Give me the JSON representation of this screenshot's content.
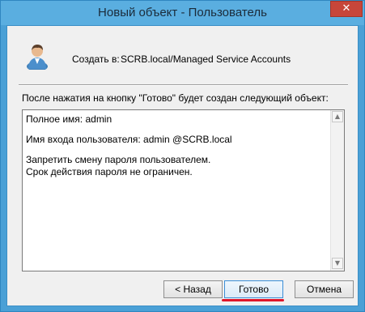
{
  "window": {
    "title": "Новый объект - Пользователь",
    "close_glyph": "✕"
  },
  "header": {
    "create_in_label": "Создать в:",
    "path": "SCRB.local/Managed Service Accounts"
  },
  "info_label": "После нажатия на кнопку \"Готово\" будет создан следующий объект:",
  "summary_lines": [
    "Полное имя: admin",
    "Имя входа пользователя: admin @SCRB.local",
    "Запретить смену пароля пользователем.",
    "Срок действия пароля не ограничен."
  ],
  "buttons": {
    "back": "< Назад",
    "finish": "Готово",
    "cancel": "Отмена"
  },
  "scrollbar": {
    "up_glyph": "▲",
    "down_glyph": "▼"
  },
  "colors": {
    "titlebar": "#5aaee0",
    "close_button": "#c7463a",
    "highlight_underline": "#e0152a"
  }
}
